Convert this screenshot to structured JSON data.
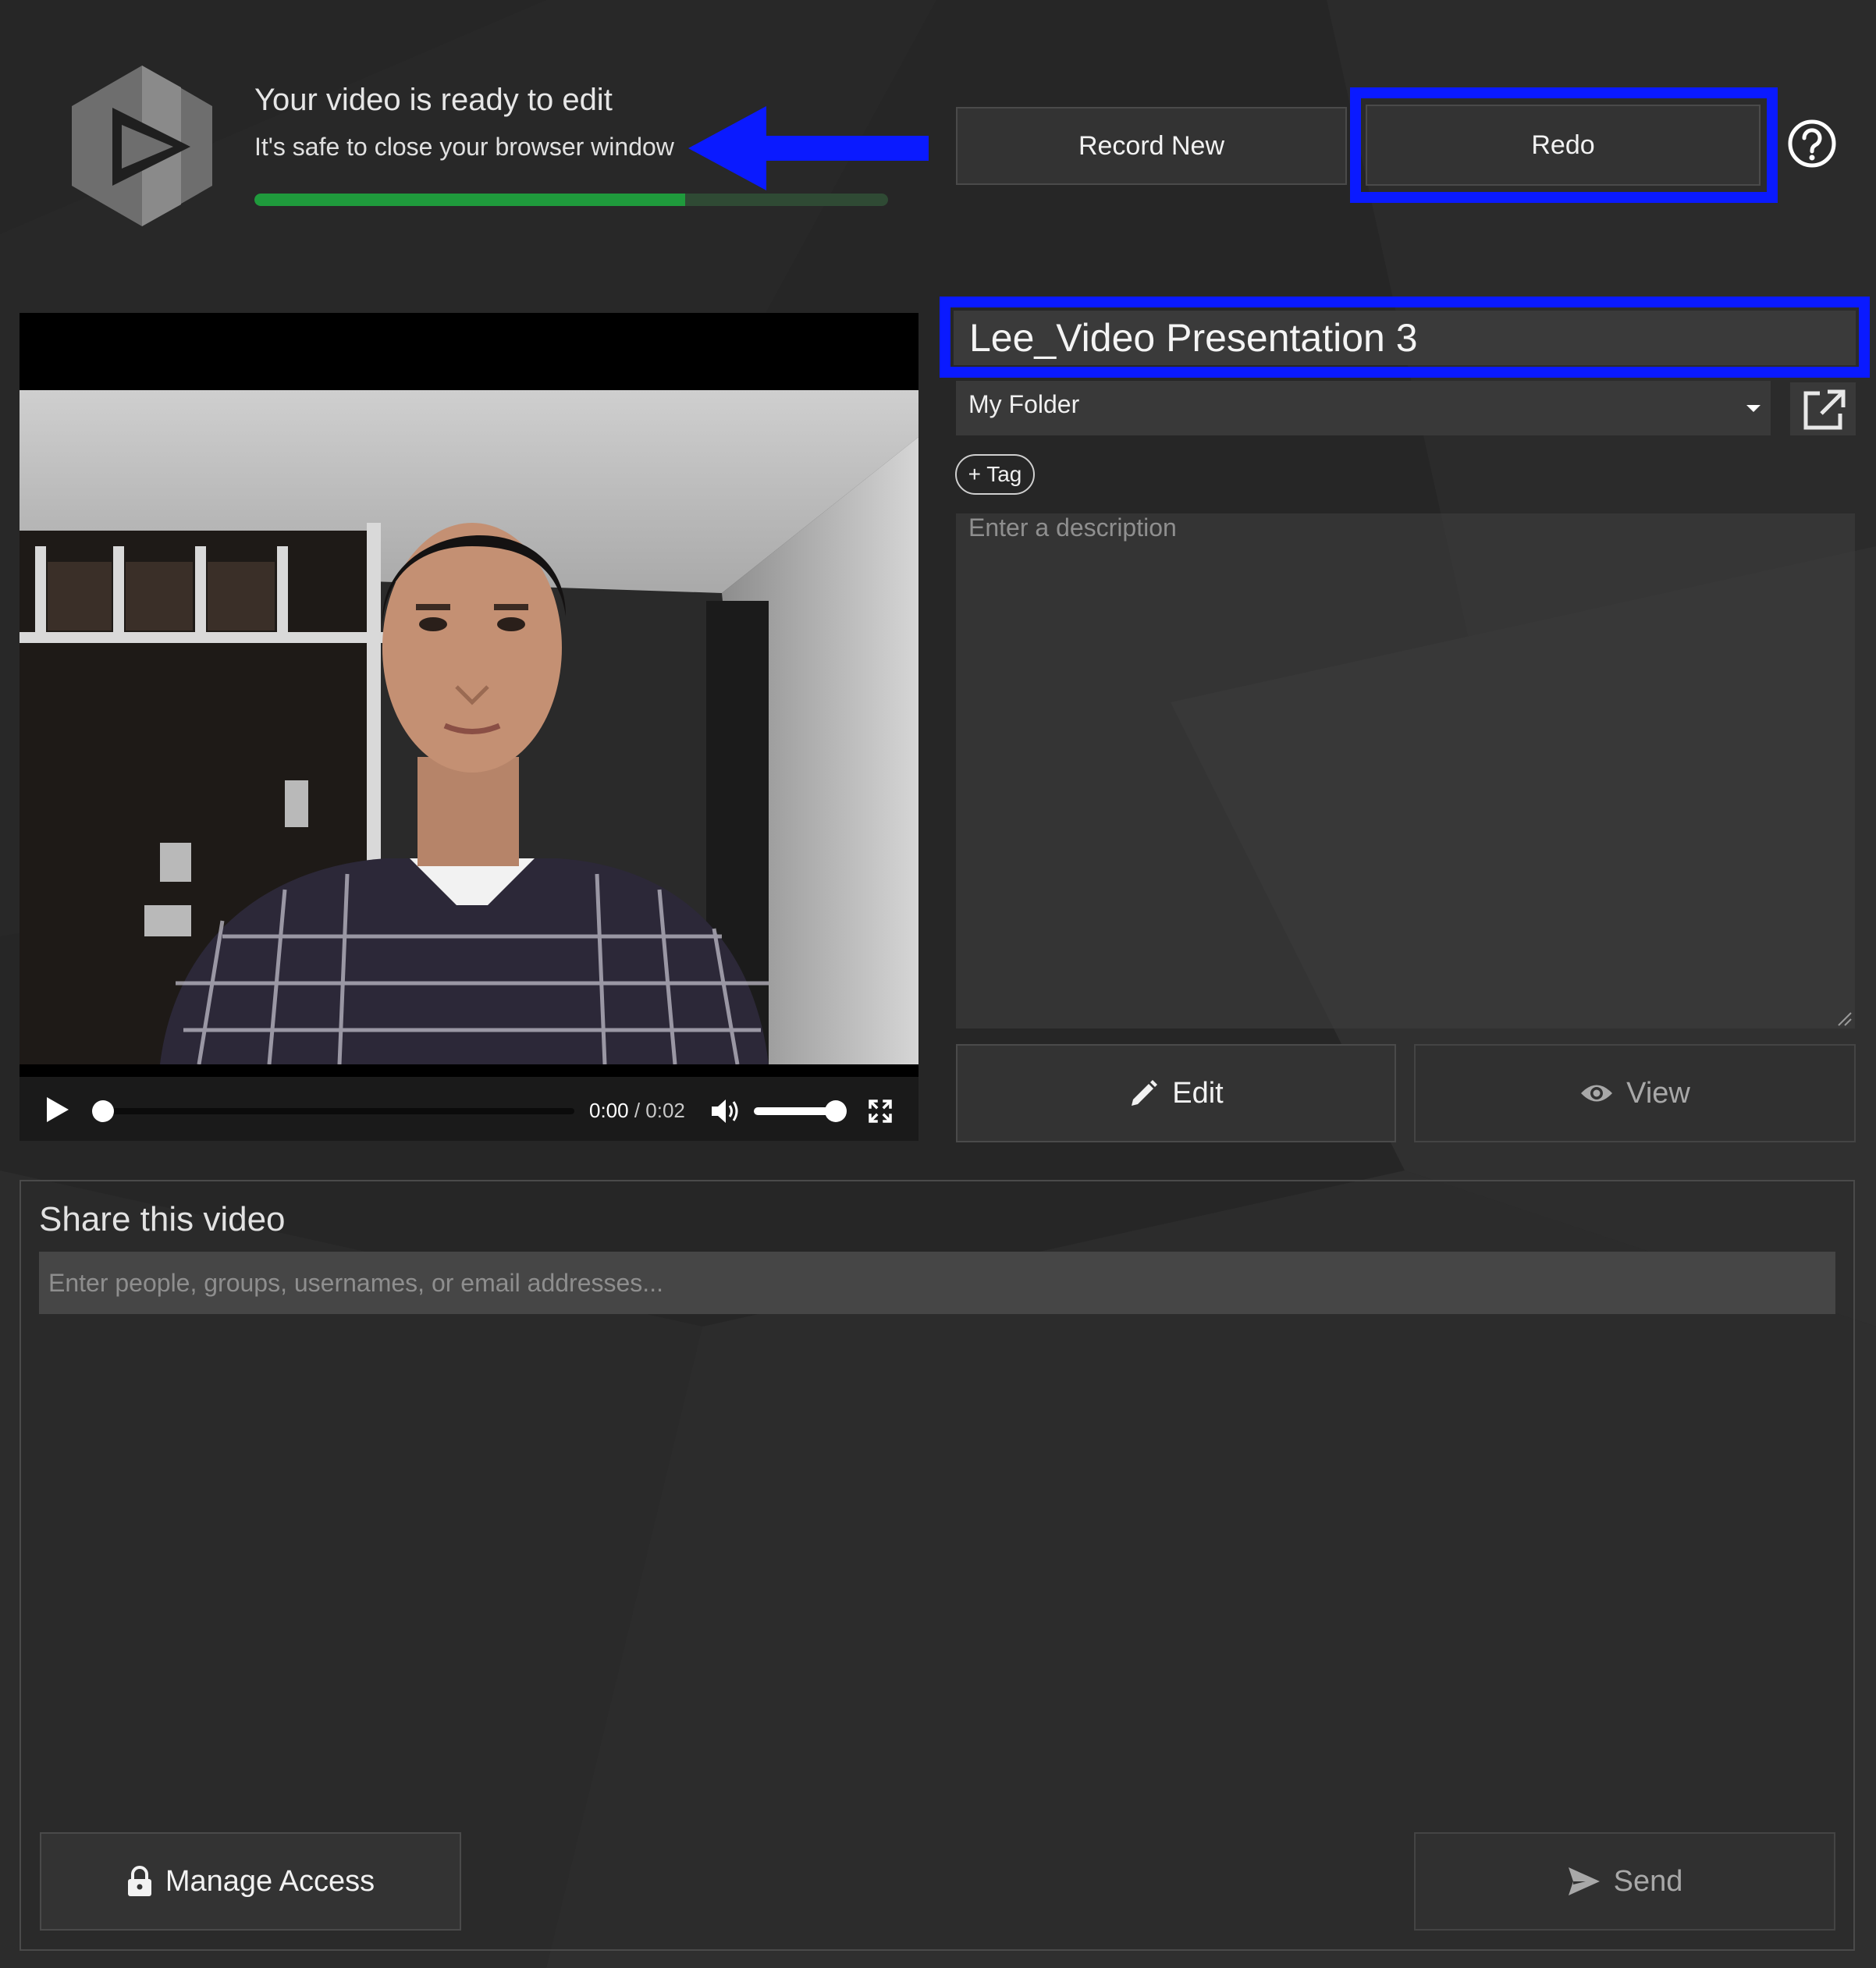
{
  "header": {
    "status_title": "Your video is ready to edit",
    "status_subtitle": "It's safe to close your browser window",
    "progress_percent": 68,
    "record_new_label": "Record New",
    "redo_label": "Redo",
    "help_icon": "help-icon"
  },
  "player": {
    "current_time": "0:00",
    "separator": " / ",
    "duration": "0:02",
    "volume_percent": 95,
    "icons": [
      "play-icon",
      "volume-icon",
      "fullscreen-icon"
    ]
  },
  "details": {
    "title_value": "Lee_Video Presentation 3",
    "folder": "My Folder",
    "tag_label": "+ Tag",
    "description_placeholder": "Enter a description",
    "edit_label": "Edit",
    "view_label": "View"
  },
  "share": {
    "title": "Share this video",
    "input_placeholder": "Enter people, groups, usernames, or email addresses...",
    "manage_access_label": "Manage Access",
    "send_label": "Send"
  },
  "colors": {
    "background": "#262626",
    "accent_highlight": "#0a1aff",
    "progress": "#1f9a3c",
    "button": "#333333"
  }
}
